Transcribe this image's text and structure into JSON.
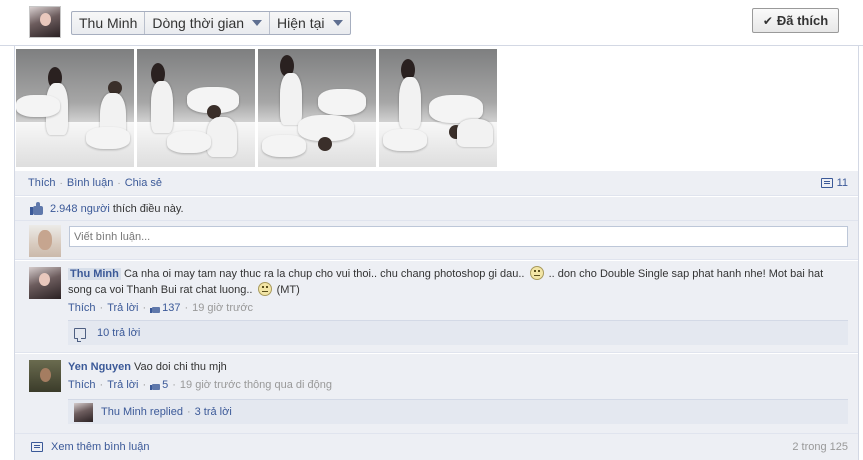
{
  "topbar": {
    "profile_name": "Thu Minh",
    "timeline_label": "Dòng thời gian",
    "current_label": "Hiện tại",
    "like_button_label": "Đã thích"
  },
  "photos": [
    {
      "name": "photo-1"
    },
    {
      "name": "photo-2"
    },
    {
      "name": "photo-3"
    },
    {
      "name": "photo-4"
    }
  ],
  "actions": {
    "like": "Thích",
    "comment": "Bình luận",
    "share": "Chia sẻ",
    "comment_count": "11"
  },
  "likes": {
    "count": "2.948 người",
    "text": "thích điều này."
  },
  "write_comment": {
    "placeholder": "Viết bình luận..."
  },
  "comments": [
    {
      "author": "Thu Minh",
      "text_part1": "Ca nha oi may tam nay thuc ra la chup cho vui thoi.. chu chang photoshop gi dau..",
      "text_part2": ".. don cho Double Single sap phat hanh nhe! Mot bai hat song ca voi Thanh Bui rat chat luong..",
      "text_part3": "(MT)",
      "like_label": "Thích",
      "reply_label": "Trả lời",
      "like_count": "137",
      "time": "19 giờ trước",
      "replies": "10 trả lời"
    },
    {
      "author": "Yen Nguyen",
      "text": "Vao doi chi thu mjh",
      "like_label": "Thích",
      "reply_label": "Trả lời",
      "like_count": "5",
      "time": "19 giờ trước thông qua di động",
      "replied_by": "Thu Minh replied",
      "replies": "3 trả lời"
    }
  ],
  "footer": {
    "more_comments": "Xem thêm bình luận",
    "pager": "2 trong 125"
  }
}
